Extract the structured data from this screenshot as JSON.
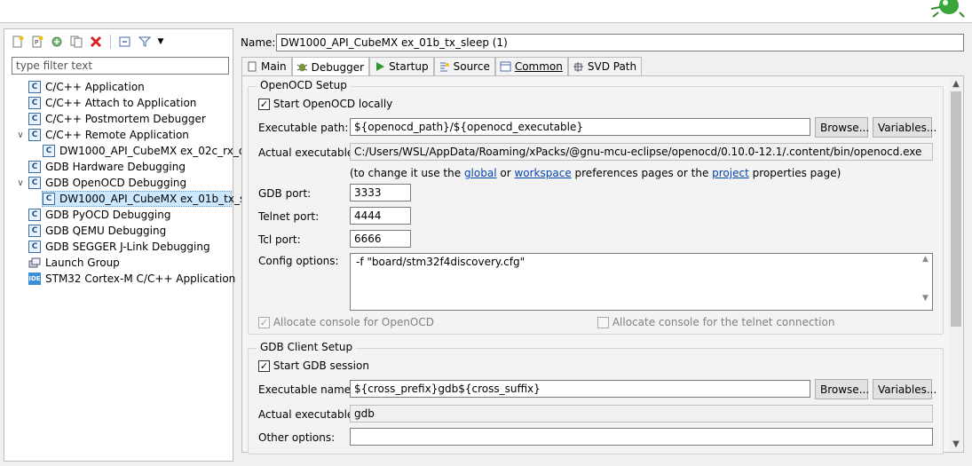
{
  "window": {
    "name_label": "Name:",
    "config_name": "DW1000_API_CubeMX ex_01b_tx_sleep (1)"
  },
  "left": {
    "filter_placeholder": "type filter text",
    "tree": [
      {
        "label": "C/C++ Application",
        "icon": "c-config-icon"
      },
      {
        "label": "C/C++ Attach to Application",
        "icon": "c-config-icon"
      },
      {
        "label": "C/C++ Postmortem Debugger",
        "icon": "c-config-icon"
      },
      {
        "label": "C/C++ Remote Application",
        "icon": "c-config-icon",
        "expanded": true
      },
      {
        "label": "DW1000_API_CubeMX ex_02c_rx_d",
        "icon": "c-config-icon",
        "child": true
      },
      {
        "label": "GDB Hardware Debugging",
        "icon": "c-config-icon"
      },
      {
        "label": "GDB OpenOCD Debugging",
        "icon": "c-config-icon",
        "expanded": true
      },
      {
        "label": "DW1000_API_CubeMX ex_01b_tx_s",
        "icon": "c-config-icon",
        "child": true,
        "selected": true
      },
      {
        "label": "GDB PyOCD Debugging",
        "icon": "c-config-icon"
      },
      {
        "label": "GDB QEMU Debugging",
        "icon": "c-config-icon"
      },
      {
        "label": "GDB SEGGER J-Link Debugging",
        "icon": "c-config-icon"
      },
      {
        "label": "Launch Group",
        "icon": "launch-group-icon"
      },
      {
        "label": "STM32 Cortex-M C/C++ Application",
        "icon": "ide-icon",
        "icon_text": "IDE"
      }
    ]
  },
  "tabs": [
    {
      "label": "Main",
      "icon": "main-tab-icon"
    },
    {
      "label": "Debugger",
      "icon": "debugger-bug-icon",
      "active": true
    },
    {
      "label": "Startup",
      "icon": "play-icon"
    },
    {
      "label": "Source",
      "icon": "source-icon"
    },
    {
      "label": "Common",
      "icon": "common-icon"
    },
    {
      "label": "SVD Path",
      "icon": "svd-icon"
    }
  ],
  "openocd": {
    "title": "OpenOCD Setup",
    "start_locally": "Start OpenOCD locally",
    "exec_label": "Executable path:",
    "exec_value": "${openocd_path}/${openocd_executable}",
    "browse": "Browse...",
    "variables": "Variables...",
    "actual_label": "Actual executable:",
    "actual_value": "C:/Users/WSL/AppData/Roaming/xPacks/@gnu-mcu-eclipse/openocd/0.10.0-12.1/.content/bin/openocd.exe",
    "hint_pre": "(to change it use the ",
    "hint_global": "global",
    "hint_or": " or ",
    "hint_workspace": "workspace",
    "hint_mid": " preferences pages or the ",
    "hint_project": "project",
    "hint_post": " properties page)",
    "gdb_port_label": "GDB port:",
    "gdb_port": "3333",
    "telnet_port_label": "Telnet port:",
    "telnet_port": "4444",
    "tcl_port_label": "Tcl port:",
    "tcl_port": "6666",
    "config_label": "Config options:",
    "config_value": "-f \"board/stm32f4discovery.cfg\"",
    "alloc_console": "Allocate console for OpenOCD",
    "alloc_telnet": "Allocate console for the telnet connection"
  },
  "gdb": {
    "title": "GDB Client Setup",
    "start_session": "Start GDB session",
    "exec_label": "Executable name:",
    "exec_value": "${cross_prefix}gdb${cross_suffix}",
    "browse": "Browse...",
    "variables": "Variables...",
    "actual_label": "Actual executable:",
    "actual_value": "gdb",
    "other_label": "Other options:",
    "other_value": ""
  }
}
